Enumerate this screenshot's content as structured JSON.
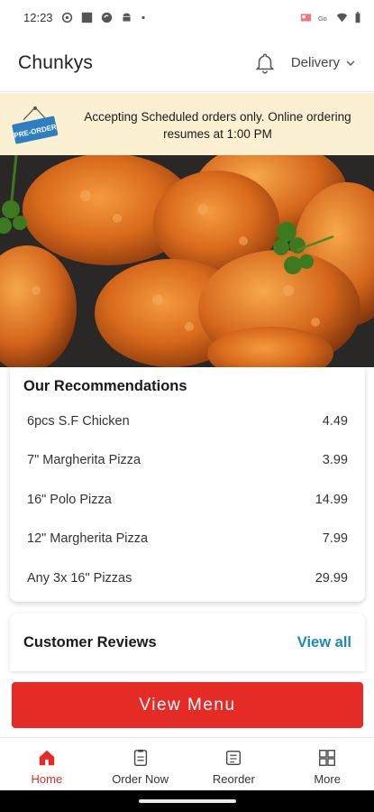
{
  "status_bar": {
    "time": "12:23",
    "icons_left": [
      "settings-icon",
      "square-app-icon",
      "sync-icon",
      "android-icon",
      "dot-icon"
    ],
    "icons_right": [
      "cast-icon",
      "volte-icon",
      "wifi-icon",
      "battery-icon"
    ]
  },
  "header": {
    "title": "Chunkys",
    "bell_icon": "bell-icon",
    "order_mode": "Delivery"
  },
  "banner": {
    "badge": "PRE-ORDER",
    "message": "Accepting Scheduled orders only. Online ordering resumes at 1:00 PM"
  },
  "recommendations": {
    "title": "Our Recommendations",
    "items": [
      {
        "name": "6pcs S.F Chicken",
        "price": "4.49"
      },
      {
        "name": "7\" Margherita Pizza",
        "price": "3.99"
      },
      {
        "name": "16\" Polo Pizza",
        "price": "14.99"
      },
      {
        "name": "12\" Margherita Pizza",
        "price": "7.99"
      },
      {
        "name": "Any 3x 16\" Pizzas",
        "price": "29.99"
      }
    ]
  },
  "reviews": {
    "title": "Customer Reviews",
    "view_all": "View all"
  },
  "view_menu_label": "View Menu",
  "nav": {
    "items": [
      {
        "label": "Home",
        "icon": "home-icon",
        "active": true
      },
      {
        "label": "Order Now",
        "icon": "order-icon",
        "active": false
      },
      {
        "label": "Reorder",
        "icon": "reorder-icon",
        "active": false
      },
      {
        "label": "More",
        "icon": "more-grid-icon",
        "active": false
      }
    ]
  },
  "colors": {
    "accent": "#e52b26",
    "link": "#1e88b5",
    "banner_bg": "#fcf0d2",
    "badge_blue": "#2d7fc1"
  }
}
